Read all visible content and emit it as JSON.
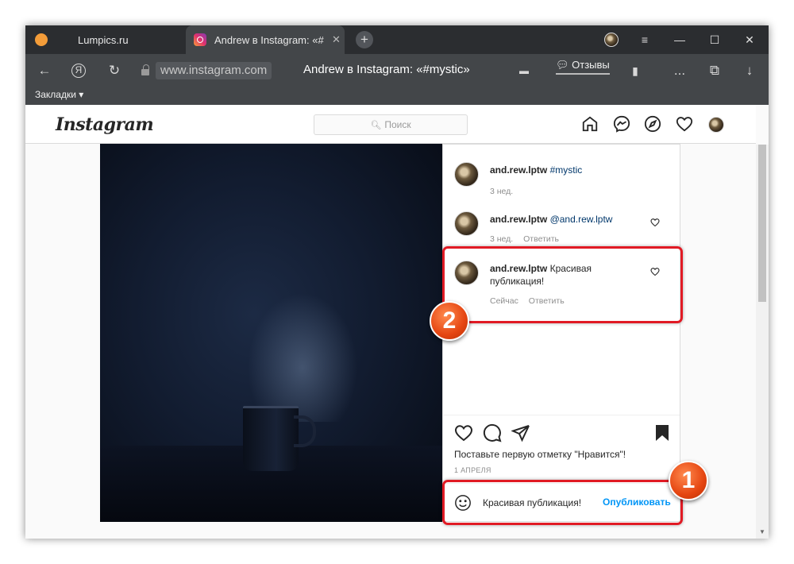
{
  "browser": {
    "tabs": [
      {
        "title": "Lumpics.ru",
        "active": false
      },
      {
        "title": "Andrew в Instagram: «#",
        "active": true
      }
    ],
    "new_tab_symbol": "+",
    "url": "www.instagram.com",
    "page_title": "Andrew в Instagram: «#mystic»",
    "reviews_label": "Отзывы",
    "more_label": "...",
    "bookmarks_label": "Закладки",
    "window_controls": [
      "minimize-icon",
      "maximize-icon",
      "close-icon"
    ]
  },
  "instagram": {
    "logo": "Instagram",
    "search_placeholder": "Поиск",
    "nav_icons": [
      "home-icon",
      "messenger-icon",
      "explore-icon",
      "heart-icon",
      "profile-avatar"
    ]
  },
  "post": {
    "comments": [
      {
        "user": "and.rew.lptw",
        "text": "#mystic",
        "tagged": true,
        "time": "3 нед.",
        "reply": ""
      },
      {
        "user": "and.rew.lptw",
        "text": "@and.rew.lptw",
        "tagged": true,
        "time": "3 нед.",
        "reply": "Ответить"
      },
      {
        "user": "and.rew.lptw",
        "text": "Красивая публикация!",
        "tagged": false,
        "time": "Сейчас",
        "reply": "Ответить"
      }
    ],
    "likes_text_before": "Поставьте первую ",
    "likes_text_bold": "отметку \"Нравится\"!",
    "date": "1 АПРЕЛЯ",
    "comment_input_value": "Красивая публикация!",
    "publish_label": "Опубликовать"
  },
  "annotations": {
    "badge_1": "1",
    "badge_2": "2",
    "highlight_color": "#e11a24",
    "badge_color": "#e54511"
  }
}
